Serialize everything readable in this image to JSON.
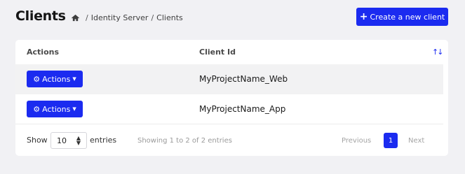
{
  "header": {
    "title": "Clients",
    "breadcrumb": [
      "Identity Server",
      "Clients"
    ],
    "breadcrumb_sep": "/",
    "create_button": "Create a new client"
  },
  "table": {
    "columns": [
      "Actions",
      "Client Id"
    ],
    "rows": [
      {
        "action_label": "Actions",
        "client_id": "MyProjectName_Web"
      },
      {
        "action_label": "Actions",
        "client_id": "MyProjectName_App"
      }
    ]
  },
  "footer": {
    "show_label": "Show",
    "page_size": "10",
    "entries_label": "entries",
    "info": "Showing 1 to 2 of 2 entries",
    "prev": "Previous",
    "current_page": "1",
    "next": "Next"
  },
  "colors": {
    "accent": "#1b2bf0",
    "background": "#f1f1f4"
  },
  "icons": [
    "home-icon",
    "plus-icon",
    "sort-icon",
    "gear-icon",
    "caret-down-icon",
    "select-arrows-icon"
  ]
}
